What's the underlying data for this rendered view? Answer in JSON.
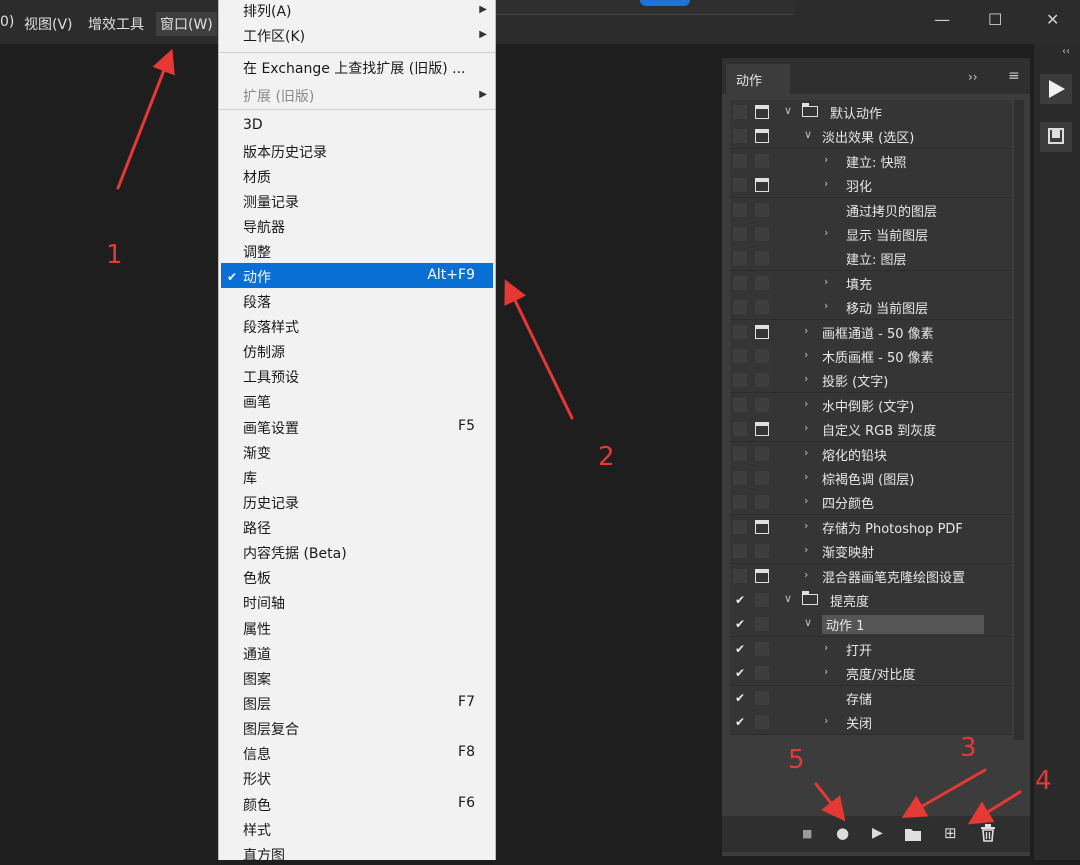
{
  "menubar": {
    "items": [
      {
        "label": "0)"
      },
      {
        "label": "视图(V)"
      },
      {
        "label": "增效工具"
      },
      {
        "label": "窗口(W)"
      }
    ],
    "window_controls": [
      "—",
      "☐",
      "✕"
    ]
  },
  "window_menu": {
    "items": [
      {
        "label": "排列(A)",
        "submenu": true
      },
      {
        "label": "工作区(K)",
        "submenu": true
      },
      {
        "label": "在 Exchange 上查找扩展 (旧版) ..."
      },
      {
        "label": "扩展 (旧版)",
        "submenu": true,
        "disabled": true
      },
      {
        "label": "3D"
      },
      {
        "label": "版本历史记录"
      },
      {
        "label": "材质"
      },
      {
        "label": "测量记录"
      },
      {
        "label": "导航器"
      },
      {
        "label": "调整"
      },
      {
        "label": "动作",
        "shortcut": "Alt+F9",
        "checked": true,
        "highlighted": true
      },
      {
        "label": "段落"
      },
      {
        "label": "段落样式"
      },
      {
        "label": "仿制源"
      },
      {
        "label": "工具预设"
      },
      {
        "label": "画笔"
      },
      {
        "label": "画笔设置",
        "shortcut": "F5"
      },
      {
        "label": "渐变"
      },
      {
        "label": "库"
      },
      {
        "label": "历史记录"
      },
      {
        "label": "路径"
      },
      {
        "label": "内容凭据 (Beta)"
      },
      {
        "label": "色板"
      },
      {
        "label": "时间轴"
      },
      {
        "label": "属性"
      },
      {
        "label": "通道"
      },
      {
        "label": "图案"
      },
      {
        "label": "图层",
        "shortcut": "F7"
      },
      {
        "label": "图层复合"
      },
      {
        "label": "信息",
        "shortcut": "F8"
      },
      {
        "label": "形状"
      },
      {
        "label": "颜色",
        "shortcut": "F6"
      },
      {
        "label": "样式"
      },
      {
        "label": "直方图"
      }
    ],
    "check_glyph": "✔"
  },
  "actions_panel": {
    "tab_label": "动作",
    "expand_glyph": "››",
    "menu_glyph": "≡",
    "rows": [
      {
        "label": "默认动作",
        "level": 0,
        "type": "set",
        "expanded": true,
        "check": false,
        "dialog": true
      },
      {
        "label": "淡出效果 (选区)",
        "level": 1,
        "expanded": true,
        "check": false,
        "dialog": true
      },
      {
        "label": "建立: 快照",
        "level": 2,
        "twisty": "right",
        "check": false,
        "dialog": false
      },
      {
        "label": "羽化",
        "level": 2,
        "twisty": "right",
        "check": false,
        "dialog": true
      },
      {
        "label": "通过拷贝的图层",
        "level": 2,
        "twisty": "none",
        "check": false,
        "dialog": false
      },
      {
        "label": "显示 当前图层",
        "level": 2,
        "twisty": "right",
        "check": false,
        "dialog": false
      },
      {
        "label": "建立: 图层",
        "level": 2,
        "twisty": "none",
        "check": false,
        "dialog": false
      },
      {
        "label": "填充",
        "level": 2,
        "twisty": "right",
        "check": false,
        "dialog": false
      },
      {
        "label": "移动 当前图层",
        "level": 2,
        "twisty": "right",
        "check": false,
        "dialog": false
      },
      {
        "label": "画框通道 - 50 像素",
        "level": 1,
        "check": false,
        "dialog": true
      },
      {
        "label": "木质画框 - 50 像素",
        "level": 1,
        "check": false,
        "dialog": false
      },
      {
        "label": "投影 (文字)",
        "level": 1,
        "check": false,
        "dialog": false
      },
      {
        "label": "水中倒影 (文字)",
        "level": 1,
        "check": false,
        "dialog": false
      },
      {
        "label": "自定义 RGB 到灰度",
        "level": 1,
        "check": false,
        "dialog": true
      },
      {
        "label": "熔化的铅块",
        "level": 1,
        "check": false,
        "dialog": false
      },
      {
        "label": "棕褐色调 (图层)",
        "level": 1,
        "check": false,
        "dialog": false
      },
      {
        "label": "四分颜色",
        "level": 1,
        "check": false,
        "dialog": false
      },
      {
        "label": "存储为 Photoshop PDF",
        "level": 1,
        "check": false,
        "dialog": true
      },
      {
        "label": "渐变映射",
        "level": 1,
        "check": false,
        "dialog": false
      },
      {
        "label": "混合器画笔克隆绘图设置",
        "level": 1,
        "check": false,
        "dialog": true
      },
      {
        "label": "提亮度",
        "level": 0,
        "type": "set",
        "expanded": true,
        "check": true,
        "dialog": false
      },
      {
        "label": "动作 1",
        "level": 1,
        "expanded": true,
        "check": true,
        "dialog": false,
        "selected": true
      },
      {
        "label": "打开",
        "level": 2,
        "twisty": "right",
        "check": true,
        "dialog": false
      },
      {
        "label": "亮度/对比度",
        "level": 2,
        "twisty": "right",
        "check": true,
        "dialog": false
      },
      {
        "label": "存储",
        "level": 2,
        "twisty": "none",
        "check": true,
        "dialog": false
      },
      {
        "label": "关闭",
        "level": 2,
        "twisty": "right",
        "check": true,
        "dialog": false
      }
    ],
    "check_glyph": "✔",
    "toolbar": {
      "stop": "■",
      "record": "●",
      "play": "▶",
      "new_set": "folder-icon",
      "new_action": "⊞",
      "delete": "trash-icon"
    }
  },
  "side_column": {
    "collapse_glyph": "‹‹"
  },
  "annotations": {
    "labels": [
      "1",
      "2",
      "3",
      "4",
      "5"
    ],
    "color": "#e53935"
  }
}
